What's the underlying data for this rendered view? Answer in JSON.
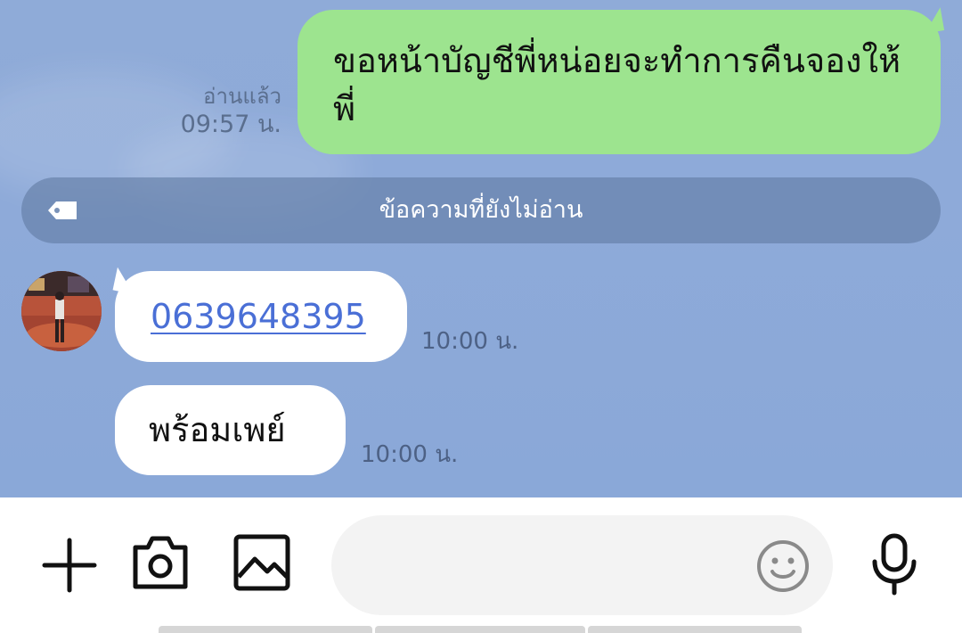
{
  "outgoing": {
    "message": "ขอหน้าบัญชีพี่หน่อยจะทำการคืนจองให้พี่",
    "read_status": "อ่านแล้ว",
    "time": "09:57 น.",
    "bubble_color": "#9de48f"
  },
  "unread_divider": {
    "label": "ข้อความที่ยังไม่อ่าน",
    "icon": "tag-icon"
  },
  "incoming": [
    {
      "text": "0639648395",
      "time": "10:00 น.",
      "is_link": true
    },
    {
      "text": "พร้อมเพย์",
      "time": "10:00 น.",
      "is_link": false
    }
  ],
  "input_bar": {
    "icons": [
      "plus-icon",
      "camera-icon",
      "image-icon",
      "emoji-icon",
      "microphone-icon"
    ],
    "placeholder": ""
  },
  "colors": {
    "chat_background": "#8eaad9",
    "link": "#4a6fd6"
  }
}
